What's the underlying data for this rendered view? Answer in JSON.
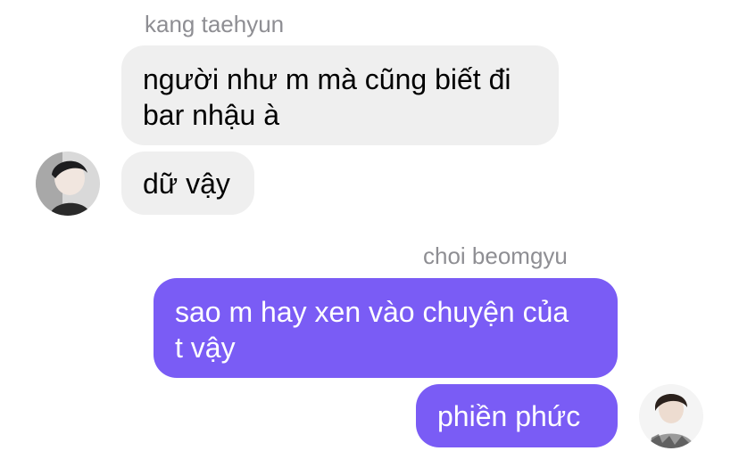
{
  "conversation": {
    "incoming_group": {
      "sender_name": "kang taehyun",
      "messages": [
        {
          "text": "người như m mà cũng biết đi\nbar nhậu à"
        },
        {
          "text": "dữ vậy"
        }
      ],
      "avatar_icon": "user-avatar-kang-taehyun"
    },
    "outgoing_group": {
      "sender_name": "choi beomgyu",
      "messages": [
        {
          "text": "sao m hay xen vào chuyện của\nt vậy"
        },
        {
          "text": "phiền phức"
        }
      ],
      "avatar_icon": "user-avatar-choi-beomgyu"
    }
  },
  "colors": {
    "incoming_bubble": "#efefef",
    "outgoing_bubble": "#7a5cf5",
    "sender_name": "#8e8e93"
  }
}
